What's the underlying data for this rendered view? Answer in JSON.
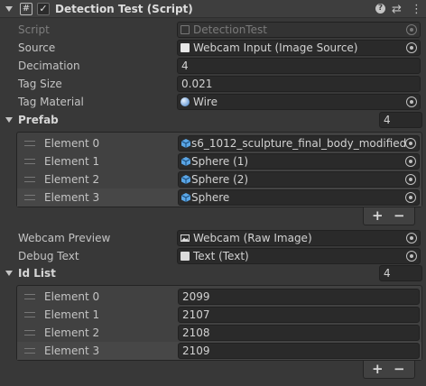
{
  "component": {
    "title": "Detection Test (Script)",
    "script_icon_glyph": "#",
    "enabled_check": "✓",
    "help_glyph": "?",
    "preset_glyph": "⇄",
    "menu_glyph": "⋮"
  },
  "fields": {
    "script": {
      "label": "Script",
      "value": "DetectionTest"
    },
    "source": {
      "label": "Source",
      "value": "Webcam Input (Image Source)"
    },
    "decimation": {
      "label": "Decimation",
      "value": "4"
    },
    "tag_size": {
      "label": "Tag Size",
      "value": "0.021"
    },
    "tag_material": {
      "label": "Tag Material",
      "value": "Wire"
    }
  },
  "prefab": {
    "label": "Prefab",
    "size": "4",
    "elements": [
      {
        "label": "Element 0",
        "value": "s6_1012_sculpture_final_body_modified"
      },
      {
        "label": "Element 1",
        "value": "Sphere (1)"
      },
      {
        "label": "Element 2",
        "value": "Sphere (2)"
      },
      {
        "label": "Element 3",
        "value": "Sphere"
      }
    ]
  },
  "webcam_preview": {
    "label": "Webcam Preview",
    "value": "Webcam (Raw Image)"
  },
  "debug_text": {
    "label": "Debug Text",
    "value": "Text (Text)"
  },
  "id_list": {
    "label": "Id List",
    "size": "4",
    "elements": [
      {
        "label": "Element 0",
        "value": "2099"
      },
      {
        "label": "Element 1",
        "value": "2107"
      },
      {
        "label": "Element 2",
        "value": "2108"
      },
      {
        "label": "Element 3",
        "value": "2109"
      }
    ]
  },
  "list_buttons": {
    "add": "+",
    "remove": "−"
  },
  "colors": {
    "background": "#383838",
    "field": "#2a2a2a",
    "selected_row": "#474747",
    "text": "#c4c4c4"
  }
}
